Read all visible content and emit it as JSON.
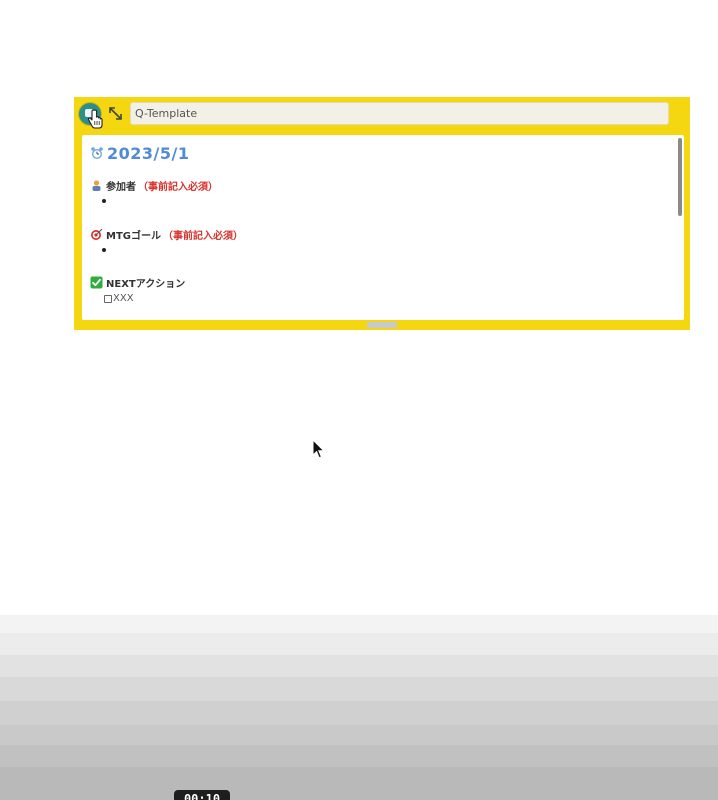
{
  "widget": {
    "title_input": {
      "value": "Q-Template"
    },
    "date": "2023/5/1",
    "sections": [
      {
        "icon": "people-icon",
        "label": "参加者",
        "required": "（事前記入必須）"
      },
      {
        "icon": "target-icon",
        "label": "MTGゴール",
        "required": "（事前記入必須）"
      },
      {
        "icon": "check-icon",
        "label": "NEXTアクション",
        "todo": "XXX"
      }
    ]
  },
  "player": {
    "timestamp": "00:10"
  },
  "colors": {
    "widget_bg": "#f4d711",
    "date_text": "#4f8bd6",
    "required_text": "#d9312b",
    "check_green": "#2fae3f"
  }
}
